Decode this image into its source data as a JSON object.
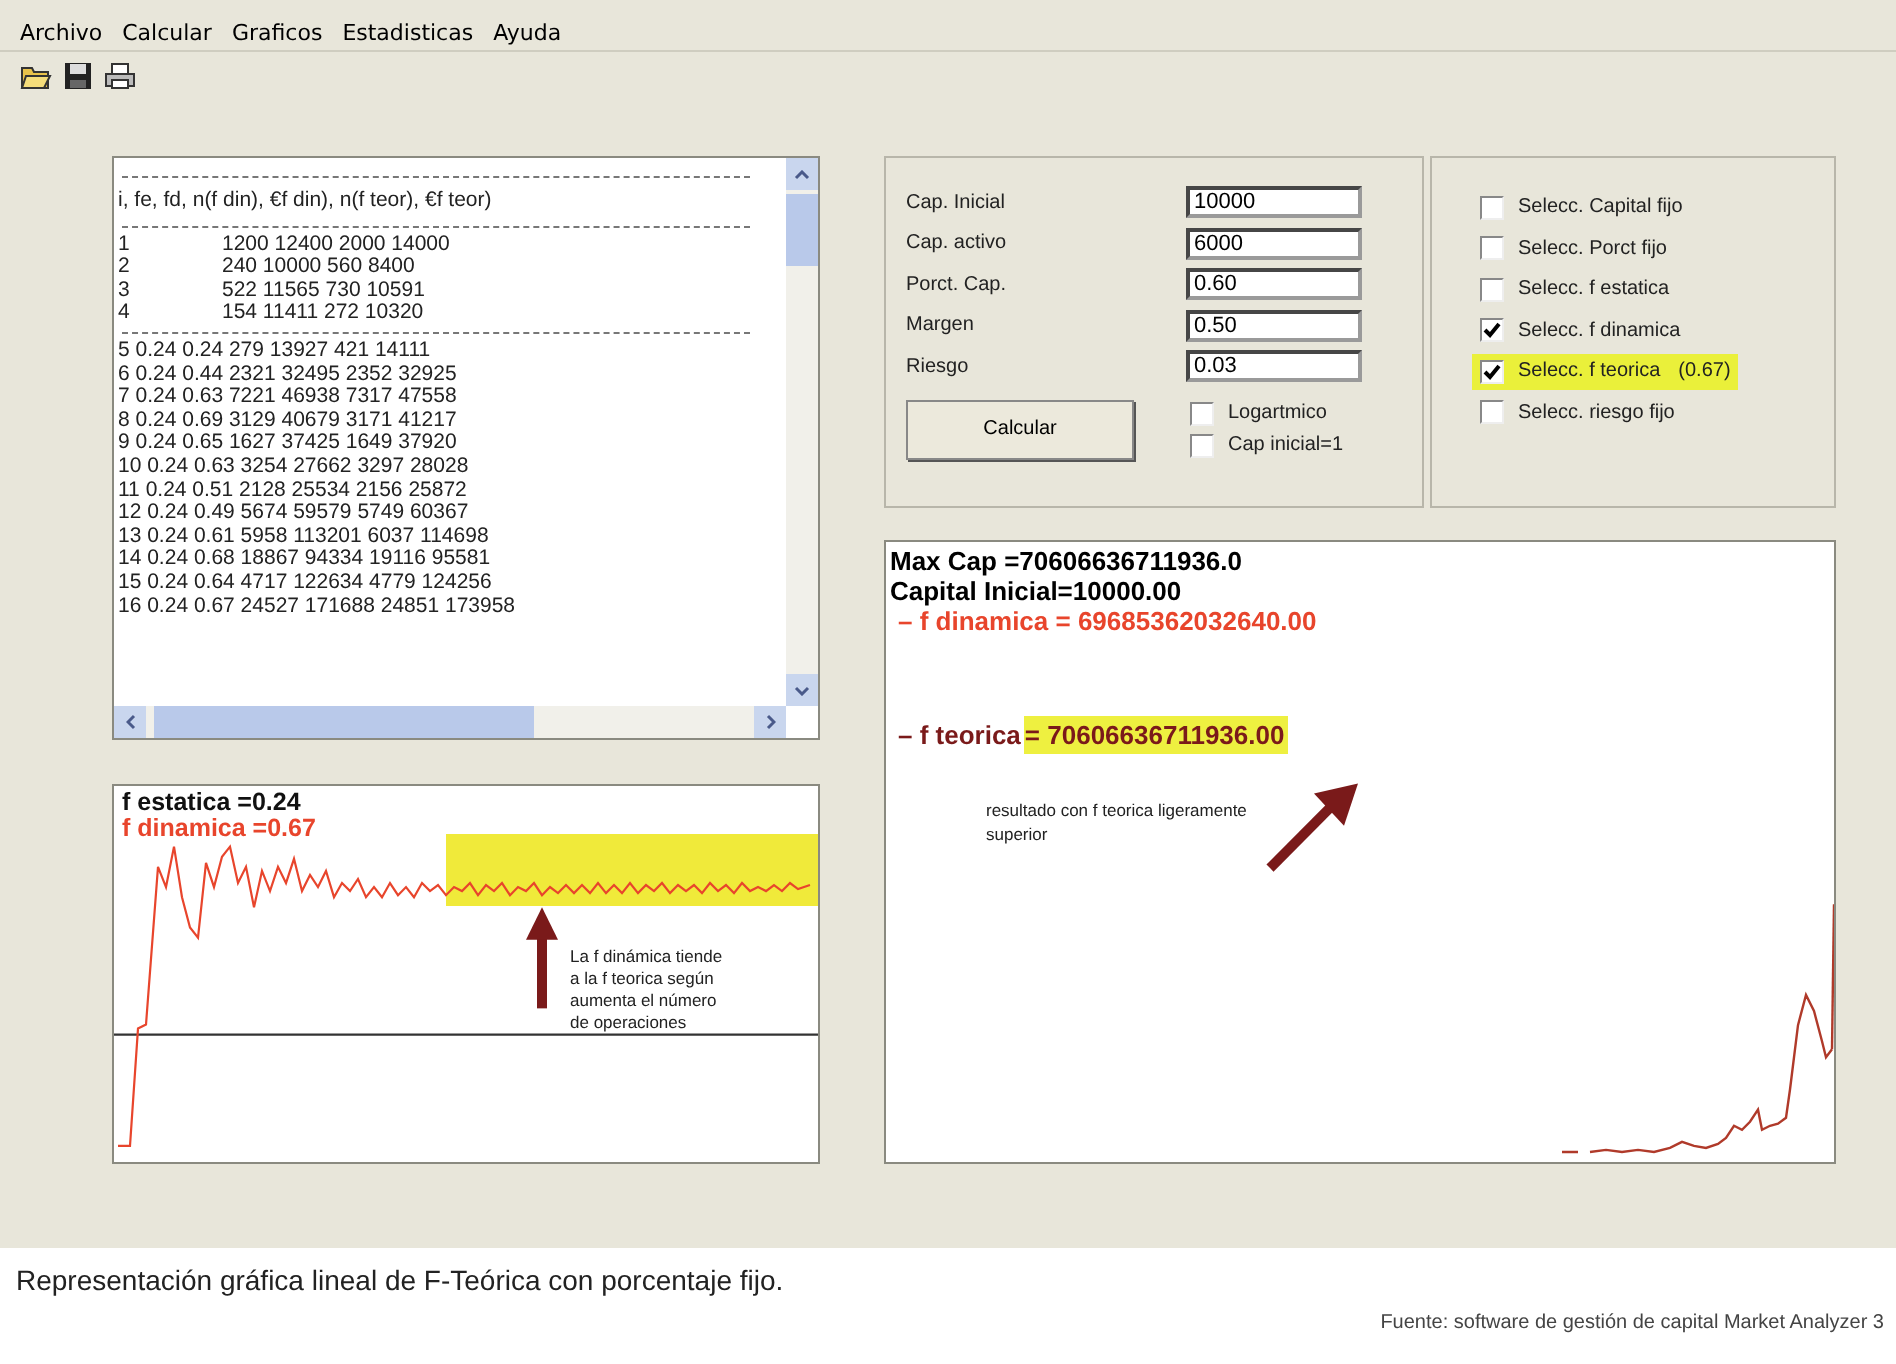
{
  "menu": [
    "Archivo",
    "Calcular",
    "Graficos",
    "Estadisticas",
    "Ayuda"
  ],
  "results_list": {
    "header": "i, fe, fd, n(f din), €f din), n(f teor), €f teor)",
    "initial_rows": [
      {
        "index": "1",
        "values": "1200 12400 2000 14000"
      },
      {
        "index": "2",
        "values": "240 10000 560 8400"
      },
      {
        "index": "3",
        "values": "522 11565 730 10591"
      },
      {
        "index": "4",
        "values": "154 11411 272 10320"
      }
    ],
    "rows": [
      "5 0.24 0.24  279 13927 421 14111",
      "6 0.24 0.44  2321 32495 2352 32925",
      "7 0.24 0.63  7221 46938 7317 47558",
      "8 0.24 0.69  3129 40679 3171 41217",
      "9 0.24 0.65  1627 37425 1649 37920",
      "10 0.24 0.63  3254 27662 3297 28028",
      "11 0.24 0.51  2128 25534 2156 25872",
      "12 0.24 0.49  5674 59579 5749 60367",
      "13 0.24 0.61  5958 113201 6037 114698",
      "14 0.24 0.68  18867 94334 19116 95581",
      "15 0.24 0.64  4717 122634 4779 124256",
      "16 0.24 0.67  24527 171688 24851 173958"
    ]
  },
  "parameters": [
    {
      "label": "Cap. Inicial",
      "value": "10000"
    },
    {
      "label": "Cap. activo",
      "value": "6000"
    },
    {
      "label": "Porct. Cap.",
      "value": "0.60"
    },
    {
      "label": "Margen",
      "value": "0.50"
    },
    {
      "label": "Riesgo",
      "value": "0.03"
    }
  ],
  "calculate_button": "Calcular",
  "options": [
    {
      "label": "Logartmico",
      "checked": false
    },
    {
      "label": "Cap inicial=1",
      "checked": false
    }
  ],
  "selections": [
    {
      "label": "Selecc. Capital fijo",
      "checked": false,
      "highlighted": false
    },
    {
      "label": "Selecc. Porct fijo",
      "checked": false,
      "highlighted": false
    },
    {
      "label": "Selecc. f estatica",
      "checked": false,
      "highlighted": false
    },
    {
      "label": "Selecc. f dinamica",
      "checked": true,
      "highlighted": false
    },
    {
      "label": "Selecc. f teorica",
      "note": "(0.67)",
      "checked": true,
      "highlighted": true
    },
    {
      "label": "Selecc. riesgo fijo",
      "checked": false,
      "highlighted": false
    }
  ],
  "f_chart": {
    "legend": [
      {
        "text": "f estatica =0.24",
        "color": "#111111"
      },
      {
        "text": "f dinamica =0.67",
        "color": "#e8452c"
      }
    ],
    "annotation": "La f dinámica tiende a la f teorica según aumenta el número de operaciones"
  },
  "capital_chart": {
    "max_cap": "Max Cap =70606636711936.0",
    "initial_capital": "Capital Inicial=10000.00",
    "dynamic_label": "– f dinamica = 69685362032640.00",
    "theoretical_label": "– f teorica",
    "theoretical_value": "= 70606636711936.00",
    "annotation": "resultado con f teorica ligeramente superior"
  },
  "caption": "Representación gráfica lineal de F-Teórica con porcentaje fijo.",
  "source": "Fuente: software de gestión de capital  Market Analyzer 3"
}
